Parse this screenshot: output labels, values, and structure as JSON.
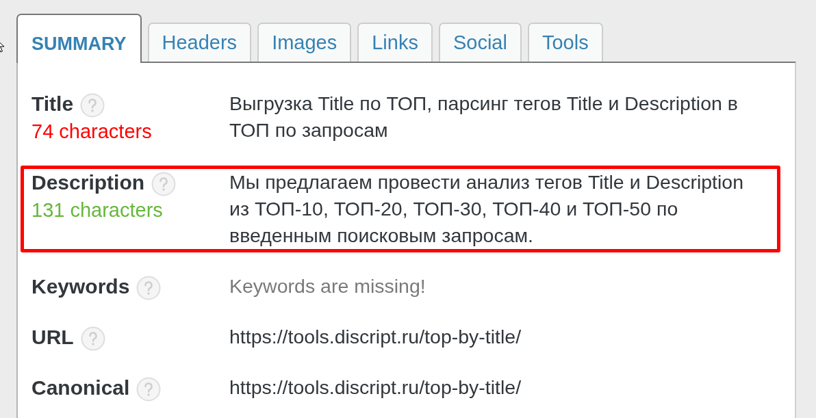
{
  "tabs": [
    {
      "label": "SUMMARY",
      "selected": true
    },
    {
      "label": "Headers",
      "selected": false
    },
    {
      "label": "Images",
      "selected": false
    },
    {
      "label": "Links",
      "selected": false
    },
    {
      "label": "Social",
      "selected": false
    },
    {
      "label": "Tools",
      "selected": false
    }
  ],
  "rows": [
    {
      "label": "Title",
      "count": {
        "text": "74 characters",
        "color": "#ff0000"
      },
      "value": "Выгрузка Title по ТОП, парсинг тегов Title и Description в ТОП по запросам",
      "missing": false,
      "highlighted": false
    },
    {
      "label": "Description",
      "count": {
        "text": "131 characters",
        "color": "#66b73c"
      },
      "value": "Мы предлагаем провести анализ тегов Title и Description из ТОП-10, ТОП-20, ТОП-30, ТОП-40 и ТОП-50 по введенным поисковым запросам.",
      "missing": false,
      "highlighted": true
    },
    {
      "label": "Keywords",
      "value": "Keywords are missing!",
      "missing": true,
      "highlighted": false
    },
    {
      "label": "URL",
      "value": "https://tools.discript.ru/top-by-title/",
      "missing": false,
      "highlighted": false
    },
    {
      "label": "Canonical",
      "value": "https://tools.discript.ru/top-by-title/",
      "missing": false,
      "highlighted": false
    }
  ]
}
